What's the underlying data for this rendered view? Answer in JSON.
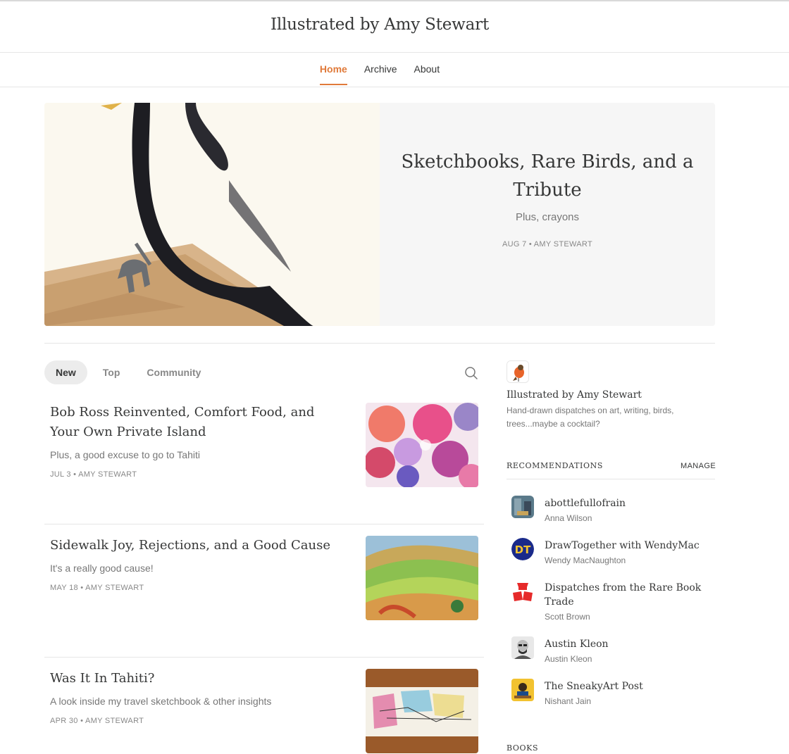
{
  "site": {
    "title": "Illustrated by Amy Stewart"
  },
  "nav": {
    "items": [
      {
        "label": "Home",
        "active": true
      },
      {
        "label": "Archive",
        "active": false
      },
      {
        "label": "About",
        "active": false
      }
    ]
  },
  "hero": {
    "title": "Sketchbooks, Rare Birds, and a Tribute",
    "subtitle": "Plus, crayons",
    "meta": "AUG 7 • AMY STEWART"
  },
  "tabs": {
    "items": [
      "New",
      "Top",
      "Community"
    ],
    "active": "New"
  },
  "posts": [
    {
      "title": "Bob Ross Reinvented, Comfort Food, and Your Own Private Island",
      "subtitle": "Plus, a good excuse to go to Tahiti",
      "meta": "JUL 3 • AMY STEWART"
    },
    {
      "title": "Sidewalk Joy, Rejections, and a Good Cause",
      "subtitle": "It's a really good cause!",
      "meta": "MAY 18 • AMY STEWART"
    },
    {
      "title": "Was It In Tahiti?",
      "subtitle": "A look inside my travel sketchbook & other insights",
      "meta": "APR 30 • AMY STEWART"
    }
  ],
  "sidebar": {
    "pub_name": "Illustrated by Amy Stewart",
    "pub_desc": "Hand-drawn dispatches on art, writing, birds, trees...maybe a cocktail?",
    "rec_header": "RECOMMENDATIONS",
    "manage_label": "MANAGE",
    "recommendations": [
      {
        "name": "abottlefullofrain",
        "author": "Anna Wilson"
      },
      {
        "name": "DrawTogether with WendyMac",
        "author": "Wendy MacNaughton"
      },
      {
        "name": "Dispatches from the Rare Book Trade",
        "author": "Scott Brown"
      },
      {
        "name": "Austin Kleon",
        "author": "Austin Kleon"
      },
      {
        "name": "The SneakyArt Post",
        "author": "Nishant Jain"
      }
    ],
    "books_label": "BOOKS"
  },
  "colors": {
    "accent": "#e07a3a",
    "text": "#363737",
    "muted": "#777777"
  }
}
